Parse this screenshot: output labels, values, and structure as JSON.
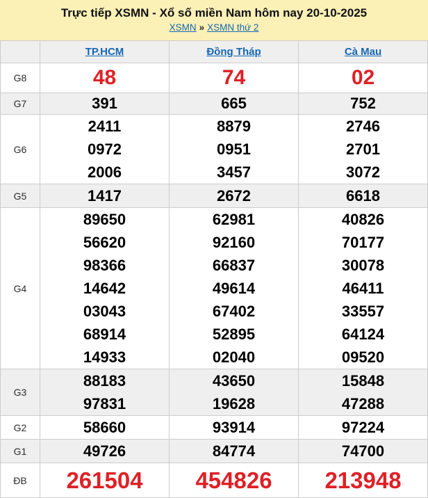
{
  "header": {
    "title": "Trực tiếp XSMN - Xổ số miền Nam hôm nay 20-10-2025",
    "breadcrumb": {
      "link1": "XSMN",
      "separator": "»",
      "link2": "XSMN thứ 2"
    }
  },
  "colors": {
    "banner_bg": "#FBF0B6",
    "alt_row_bg": "#EFEFEF",
    "border": "#CCCCCC",
    "link_blue": "#1667B1",
    "prize_red": "#DE2126"
  },
  "table": {
    "columns": [
      "TP.HCM",
      "Đồng Tháp",
      "Cà Mau"
    ],
    "rows": [
      {
        "label": "G8",
        "cols": [
          [
            "48"
          ],
          [
            "74"
          ],
          [
            "02"
          ]
        ]
      },
      {
        "label": "G7",
        "cols": [
          [
            "391"
          ],
          [
            "665"
          ],
          [
            "752"
          ]
        ]
      },
      {
        "label": "G6",
        "cols": [
          [
            "2411",
            "0972",
            "2006"
          ],
          [
            "8879",
            "0951",
            "3457"
          ],
          [
            "2746",
            "2701",
            "3072"
          ]
        ]
      },
      {
        "label": "G5",
        "cols": [
          [
            "1417"
          ],
          [
            "2672"
          ],
          [
            "6618"
          ]
        ]
      },
      {
        "label": "G4",
        "cols": [
          [
            "89650",
            "56620",
            "98366",
            "14642",
            "03043",
            "68914",
            "14933"
          ],
          [
            "62981",
            "92160",
            "66837",
            "49614",
            "67402",
            "52895",
            "02040"
          ],
          [
            "40826",
            "70177",
            "30078",
            "46411",
            "33557",
            "64124",
            "09520"
          ]
        ]
      },
      {
        "label": "G3",
        "cols": [
          [
            "88183",
            "97831"
          ],
          [
            "43650",
            "19628"
          ],
          [
            "15848",
            "47288"
          ]
        ]
      },
      {
        "label": "G2",
        "cols": [
          [
            "58660"
          ],
          [
            "93914"
          ],
          [
            "97224"
          ]
        ]
      },
      {
        "label": "G1",
        "cols": [
          [
            "49726"
          ],
          [
            "84774"
          ],
          [
            "74700"
          ]
        ]
      },
      {
        "label": "ĐB",
        "cols": [
          [
            "261504"
          ],
          [
            "454826"
          ],
          [
            "213948"
          ]
        ]
      }
    ]
  }
}
